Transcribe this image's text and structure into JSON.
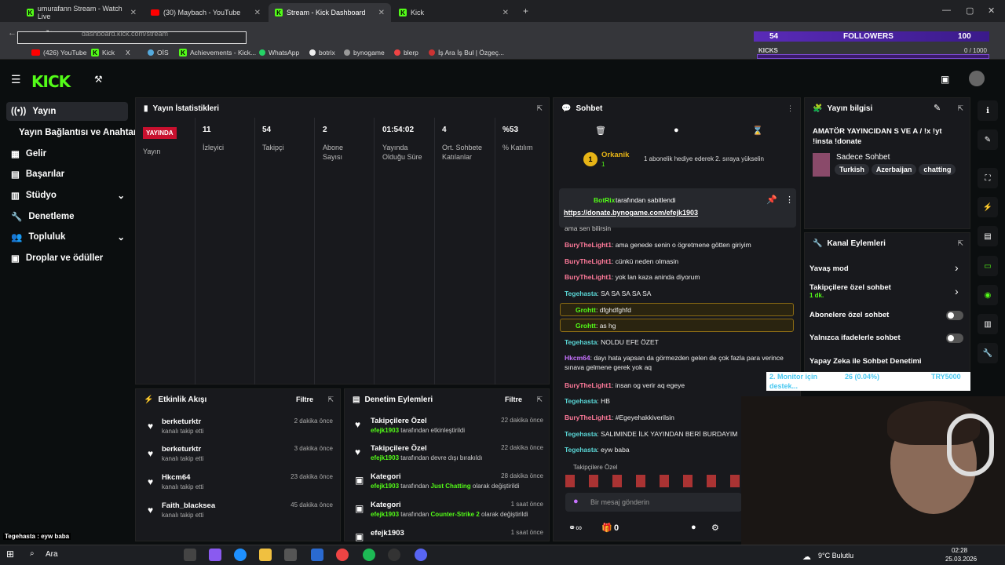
{
  "browser": {
    "tabs": [
      {
        "title": "umurafann Stream - Watch Live"
      },
      {
        "title": "(30) Maybach - YouTube"
      },
      {
        "title": "Stream - Kick Dashboard"
      },
      {
        "title": "Kick"
      }
    ],
    "url": "dashboard.kick.com/stream",
    "bookmarks": [
      "(426) YouTube",
      "Kick",
      "X",
      "OİS",
      "Achievements - Kick...",
      "WhatsApp",
      "botrix",
      "bynogame",
      "blerp",
      "İş Ara İş Bul | Özgeç..."
    ]
  },
  "overlay": {
    "followers_count": "54",
    "followers_label": "FOLLOWERS",
    "followers_goal": "100",
    "kicks_label": "KICKS",
    "kicks_value": "0 / 1000",
    "mini_lines": [
      "2. Monitor için",
      "26 (0.04%)",
      "TRY5000",
      "destek..."
    ]
  },
  "logo": "KICK",
  "sidebar": [
    "Yayın",
    "Yayın Bağlantısı ve Anahtarı",
    "Gelir",
    "Başarılar",
    "Stüdyo",
    "Denetleme",
    "Topluluk",
    "Droplar ve ödüller"
  ],
  "stats": {
    "title": "Yayın İstatistikleri",
    "badge": "YAYINDA",
    "items": [
      {
        "value": "",
        "label": "Yayın"
      },
      {
        "value": "11",
        "label": "İzleyici"
      },
      {
        "value": "54",
        "label": "Takipçi"
      },
      {
        "value": "2",
        "label": "Abone Sayısı"
      },
      {
        "value": "01:54:02",
        "label": "Yayında Olduğu Süre"
      },
      {
        "value": "4",
        "label": "Ort. Sohbete Katılanlar"
      },
      {
        "value": "%53",
        "label": "% Katılım"
      }
    ]
  },
  "activity": {
    "title": "Etkinlik Akışı",
    "filter": "Filtre",
    "items": [
      {
        "name": "berketurktr",
        "sub": "kanalı takip etti",
        "time": "2 dakika önce"
      },
      {
        "name": "berketurktr",
        "sub": "kanalı takip etti",
        "time": "3 dakika önce"
      },
      {
        "name": "Hkcm64",
        "sub": "kanalı takip etti",
        "time": "23 dakika önce"
      },
      {
        "name": "Faith_blacksea",
        "sub": "kanalı takip etti",
        "time": "45 dakika önce"
      }
    ]
  },
  "modlog": {
    "title": "Denetim Eylemleri",
    "filter": "Filtre",
    "items": [
      {
        "title": "Takipçilere Özel",
        "user": "efejk1903",
        "rest": "tarafından etkinleştirildi",
        "time": "22 dakika önce"
      },
      {
        "title": "Takipçilere Özel",
        "user": "efejk1903",
        "rest": "tarafından devre dışı bırakıldı",
        "time": "22 dakika önce"
      },
      {
        "title": "Kategori",
        "user": "efejk1903",
        "rest": "tarafından",
        "cat": "Just Chatting",
        "rest2": "olarak değiştirildi",
        "time": "28 dakika önce"
      },
      {
        "title": "Kategori",
        "user": "efejk1903",
        "rest": "tarafından",
        "cat": "Counter-Strike 2",
        "rest2": "olarak değiştirildi",
        "time": "1 saat önce"
      },
      {
        "title": "efejk1903",
        "user": "",
        "rest": "",
        "time": "1 saat önce"
      }
    ]
  },
  "chat": {
    "title": "Sohbet",
    "top_user": "Orkanik",
    "top_rank": "1",
    "top_sub": "1",
    "sub_text": "1 abonelik hediye ederek 2. sıraya yükselin",
    "pinned_by": "BotRix",
    "pinned_label": "tarafından sabitlendi",
    "pinned_link": "https://donate.bynogame.com/efejk1903",
    "messages": [
      {
        "user": "",
        "text": "ama sen bilirsin",
        "color": "#ccc"
      },
      {
        "user": "BuryTheLight1",
        "text": "ama genede senin o ögretmene götten giriyim",
        "color": "#ff7a9a"
      },
      {
        "user": "BuryTheLight1",
        "text": "cünkü neden olmasin",
        "color": "#ff7a9a"
      },
      {
        "user": "BuryTheLight1",
        "text": "yok lan kaza aninda diyorum",
        "color": "#ff7a9a"
      },
      {
        "user": "Tegehasta",
        "text": "SA SA SA SA SA",
        "color": "#5ad6d6"
      },
      {
        "user": "Grohtt",
        "text": "dfghdfghfd",
        "color": "#53fc18"
      },
      {
        "user": "Grohtt",
        "text": "as hg",
        "color": "#53fc18"
      },
      {
        "user": "Tegehasta",
        "text": "NOLDU EFE ÖZET",
        "color": "#5ad6d6"
      },
      {
        "user": "Hkcm64",
        "text": "dayı hata yapsan da görmezden gelen de çok fazla para verince sınava gelmene gerek yok aq",
        "color": "#c772ff"
      },
      {
        "user": "BuryTheLight1",
        "text": "insan og verir aq egeye",
        "color": "#ff7a9a"
      },
      {
        "user": "Tegehasta",
        "text": "HB",
        "color": "#5ad6d6"
      },
      {
        "user": "BuryTheLight1",
        "text": "#Egeyehakkiverilsin",
        "color": "#ff7a9a"
      },
      {
        "user": "Tegehasta",
        "text": "SALIMINDE İLK YAYINDAN BERİ BURDAYIM",
        "color": "#5ad6d6"
      },
      {
        "user": "Tegehasta",
        "text": "eyw baba",
        "color": "#5ad6d6"
      }
    ],
    "followers_only": "Takipçilere Özel",
    "input_placeholder": "Bir mesaj gönderin",
    "kick_count": "0"
  },
  "info": {
    "title": "Yayın bilgisi",
    "stream_title": "AMATÖR YAYINCIDAN S VE A / !x !yt !insta !donate",
    "category": "Sadece Sohbet",
    "tags": [
      "Turkish",
      "Azerbaijan",
      "chatting"
    ]
  },
  "channel": {
    "title": "Kanal Eylemleri",
    "actions": [
      {
        "label": "Yavaş mod",
        "sub": ""
      },
      {
        "label": "Takipçilere özel sohbet",
        "sub": "1 dk."
      },
      {
        "label": "Abonelere özel sohbet",
        "sub": ""
      },
      {
        "label": "Yalnızca ifadelerle sohbet",
        "sub": ""
      },
      {
        "label": "Yapay Zeka ile Sohbet Denetimi",
        "sub": ""
      }
    ]
  },
  "bottom_overlay": "Tegehasta : eyw baba",
  "taskbar": {
    "search": "Ara",
    "weather": "9°C Bulutlu",
    "time": "02:28",
    "date": "25.03.2026"
  }
}
